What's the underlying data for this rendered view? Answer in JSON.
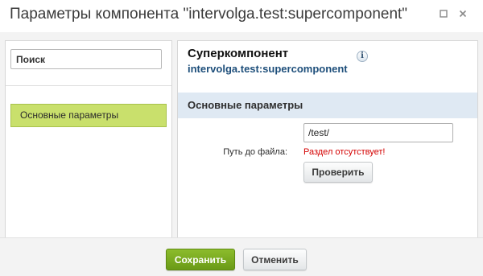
{
  "window": {
    "title": "Параметры компонента \"intervolga.test:supercomponent\"",
    "expand_icon": "expand-icon",
    "close_icon": "close-icon"
  },
  "sidebar": {
    "search_placeholder": "Поиск",
    "items": [
      {
        "label": "Основные параметры",
        "selected": true
      }
    ]
  },
  "component": {
    "name": "Суперкомпонент",
    "id": "intervolga.test:supercomponent",
    "info_icon": "info-icon"
  },
  "section": {
    "title": "Основные параметры",
    "field": {
      "label": "Путь до файла:",
      "value": "/test/",
      "error": "Раздел отсутствует!",
      "check_label": "Проверить"
    }
  },
  "footer": {
    "save_label": "Сохранить",
    "cancel_label": "Отменить"
  },
  "colors": {
    "accent_green": "#7cab22",
    "selected_item_bg": "#c9e06c",
    "section_header_bg": "#dfe9f3",
    "component_id": "#1d4e7a",
    "error": "#d40000"
  }
}
